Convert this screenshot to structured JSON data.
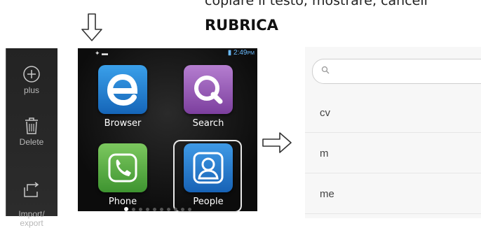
{
  "header": {
    "cut_text": "copiare il testo, mostrare, cancell",
    "title": "RUBRICA"
  },
  "sidebar": {
    "items": [
      {
        "label": "plus",
        "icon": "plus-circle-icon"
      },
      {
        "label": "Delete",
        "icon": "trash-icon"
      },
      {
        "label": "Import/\nexport",
        "icon": "import-export-icon"
      }
    ]
  },
  "phone": {
    "status_time": "2:49",
    "status_suffix": "PM",
    "apps": [
      {
        "label": "Browser",
        "icon": "browser-e-icon",
        "color": "#1e88d8"
      },
      {
        "label": "Search",
        "icon": "search-q-icon",
        "color": "#9b5bb8"
      },
      {
        "label": "Phone",
        "icon": "phone-handset-icon",
        "color": "#5fb246"
      },
      {
        "label": "People",
        "icon": "people-person-icon",
        "color": "#1f7fd0"
      }
    ],
    "page_indicator": {
      "pages": 10,
      "current": 1
    }
  },
  "contacts": {
    "search_placeholder": "",
    "rows": [
      "cv",
      "m",
      "me"
    ]
  }
}
